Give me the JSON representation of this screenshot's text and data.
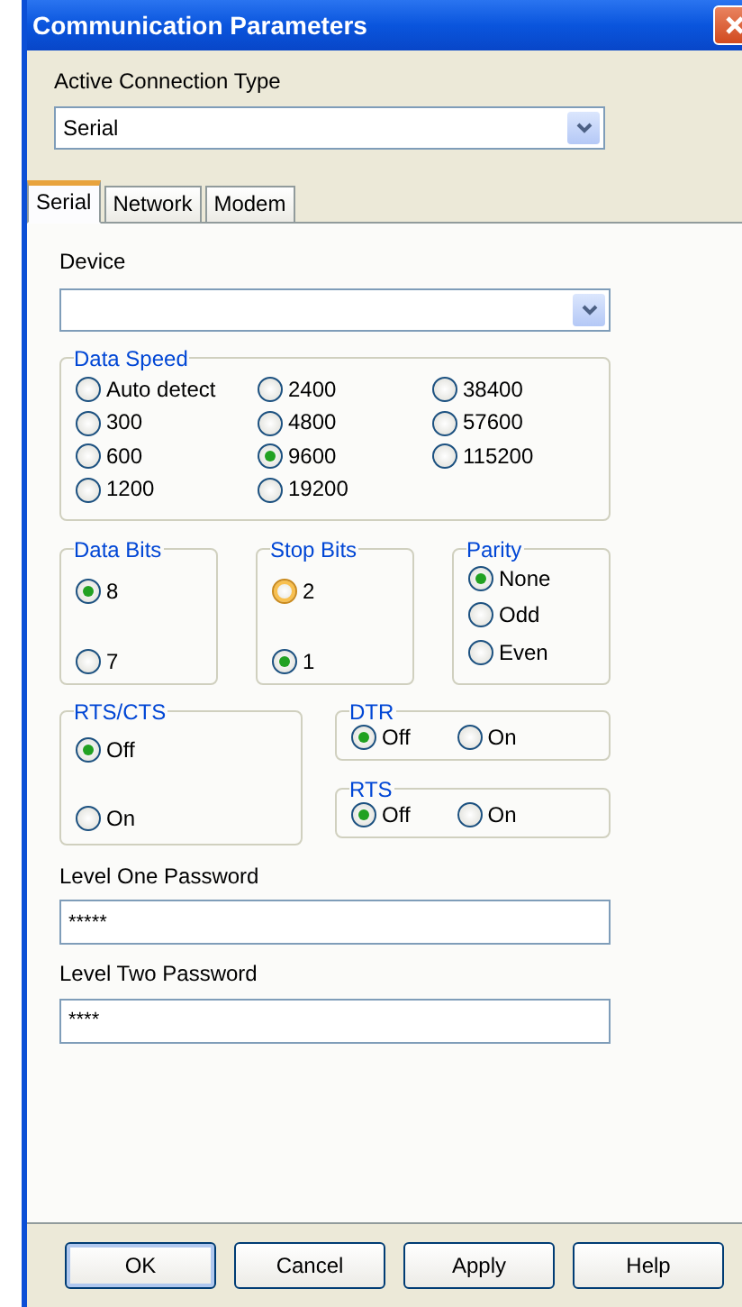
{
  "window": {
    "title": "Communication Parameters"
  },
  "connection_type": {
    "label": "Active Connection Type",
    "value": "Serial"
  },
  "tabs": [
    {
      "label": "Serial",
      "selected": true
    },
    {
      "label": "Network",
      "selected": false
    },
    {
      "label": "Modem",
      "selected": false
    }
  ],
  "device": {
    "label": "Device"
  },
  "data_speed": {
    "title": "Data Speed",
    "options": [
      {
        "label": "Auto detect",
        "selected": false
      },
      {
        "label": "300",
        "selected": false
      },
      {
        "label": "600",
        "selected": false
      },
      {
        "label": "1200",
        "selected": false
      },
      {
        "label": "2400",
        "selected": false
      },
      {
        "label": "4800",
        "selected": false
      },
      {
        "label": "9600",
        "selected": true
      },
      {
        "label": "19200",
        "selected": false
      },
      {
        "label": "38400",
        "selected": false
      },
      {
        "label": "57600",
        "selected": false
      },
      {
        "label": "115200",
        "selected": false
      }
    ]
  },
  "data_bits": {
    "title": "Data Bits",
    "options": [
      {
        "label": "8",
        "selected": true
      },
      {
        "label": "7",
        "selected": false
      }
    ]
  },
  "stop_bits": {
    "title": "Stop Bits",
    "options": [
      {
        "label": "2",
        "selected": false,
        "hovered": true
      },
      {
        "label": "1",
        "selected": true,
        "hovered": false
      }
    ]
  },
  "parity": {
    "title": "Parity",
    "options": [
      {
        "label": "None",
        "selected": true
      },
      {
        "label": "Odd",
        "selected": false
      },
      {
        "label": "Even",
        "selected": false
      }
    ]
  },
  "rts_cts": {
    "title": "RTS/CTS",
    "options": [
      {
        "label": "Off",
        "selected": true
      },
      {
        "label": "On",
        "selected": false
      }
    ]
  },
  "dtr": {
    "title": "DTR",
    "options": [
      {
        "label": "Off",
        "selected": true
      },
      {
        "label": "On",
        "selected": false
      }
    ]
  },
  "rts": {
    "title": "RTS",
    "options": [
      {
        "label": "Off",
        "selected": true
      },
      {
        "label": "On",
        "selected": false
      }
    ]
  },
  "level_one_password": {
    "label": "Level One Password",
    "value": "*****"
  },
  "level_two_password": {
    "label": "Level Two Password",
    "value": "****"
  },
  "buttons": [
    {
      "label": "OK",
      "default": true
    },
    {
      "label": "Cancel",
      "default": false
    },
    {
      "label": "Apply",
      "default": false
    },
    {
      "label": "Help",
      "default": false
    }
  ]
}
